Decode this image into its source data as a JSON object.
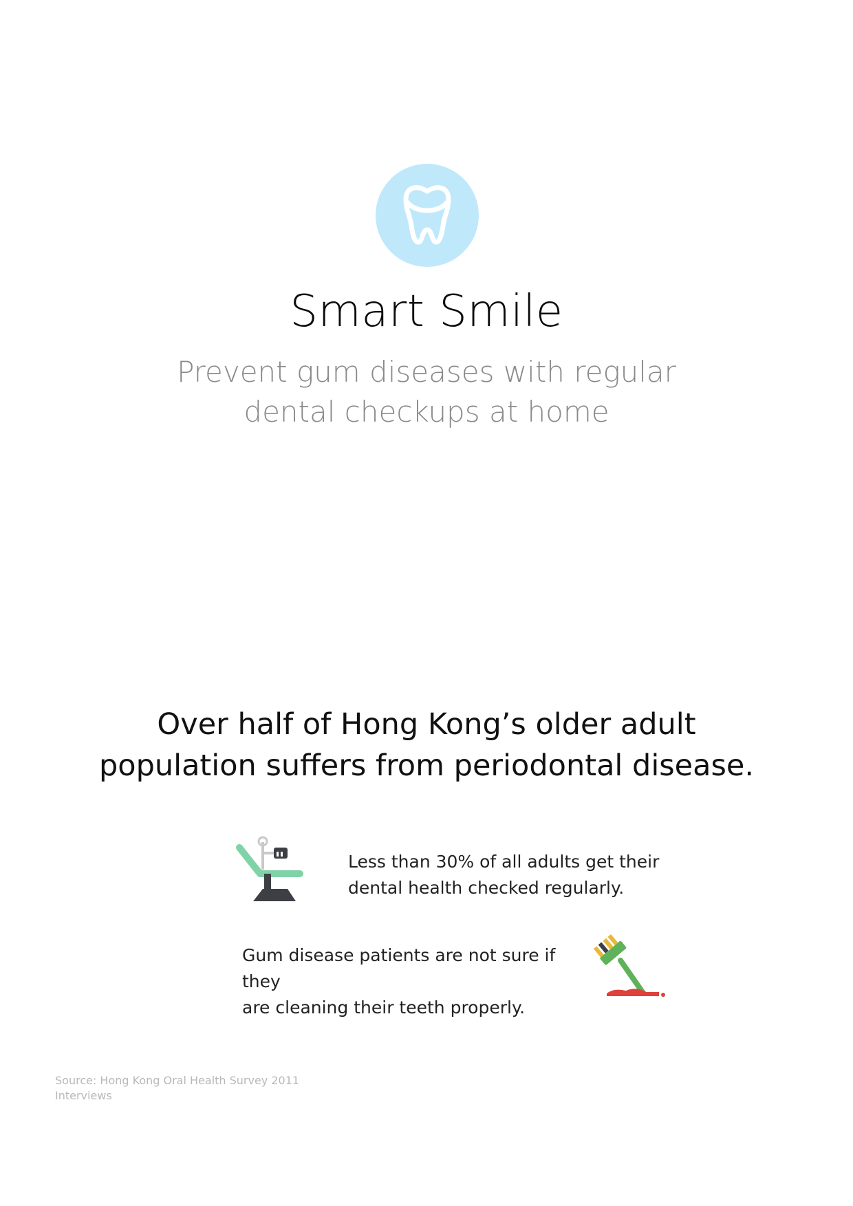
{
  "header": {
    "logo_icon": "tooth-icon",
    "logo_color": "#bfe9fb",
    "title": "Smart Smile",
    "subtitle_line1": "Prevent gum diseases with regular",
    "subtitle_line2": "dental checkups at home"
  },
  "main": {
    "headline_line1": "Over half of Hong Kong’s older adult",
    "headline_line2": "population suffers from periodontal disease.",
    "facts": [
      {
        "icon": "dental-chair-icon",
        "line1": "Less than 30% of all adults get their",
        "line2": "dental health checked regularly."
      },
      {
        "icon": "bleeding-toothbrush-icon",
        "line1": "Gum disease patients are not sure if they",
        "line2": "are cleaning their teeth properly."
      }
    ]
  },
  "footer": {
    "source_line1": "Source: Hong Kong Oral Health Survey 2011",
    "source_line2": "Interviews"
  },
  "colors": {
    "accent": "#bfe9fb",
    "chair_green": "#7fd3a6",
    "chair_dark": "#3d3f45",
    "brush_green": "#5fb25a",
    "brush_yellow": "#e8b93a",
    "blood_red": "#e0403a"
  }
}
